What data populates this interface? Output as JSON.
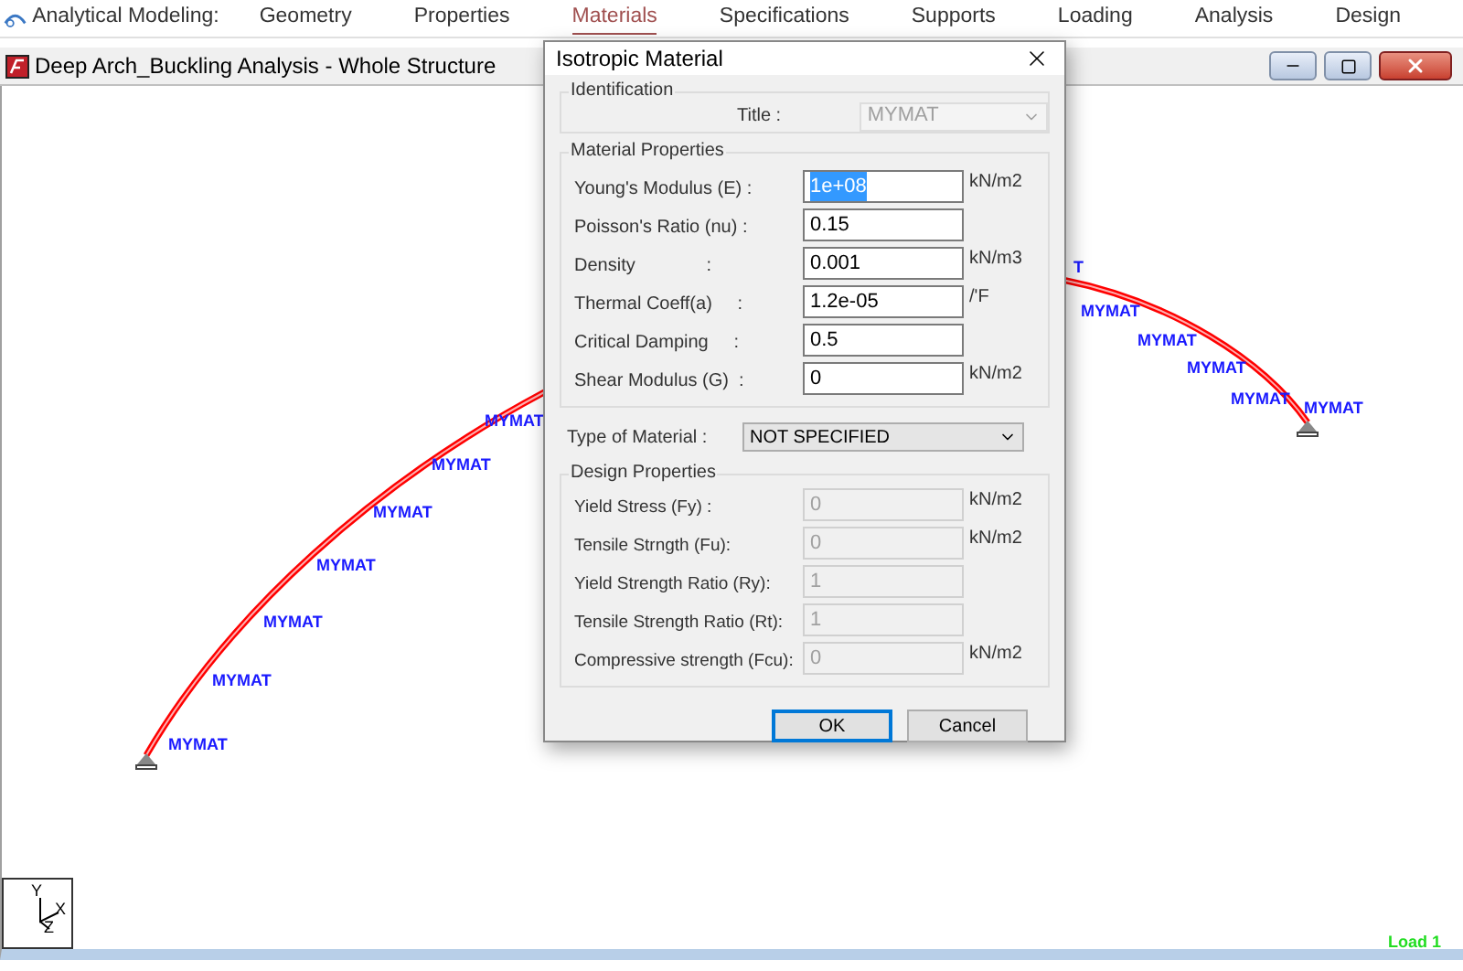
{
  "menu": {
    "app_label": "Analytical Modeling:",
    "items": [
      {
        "label": "Geometry",
        "selected": false
      },
      {
        "label": "Properties",
        "selected": false
      },
      {
        "label": "Materials",
        "selected": true
      },
      {
        "label": "Specifications",
        "selected": false
      },
      {
        "label": "Supports",
        "selected": false
      },
      {
        "label": "Loading",
        "selected": false
      },
      {
        "label": "Analysis",
        "selected": false
      },
      {
        "label": "Design",
        "selected": false
      }
    ]
  },
  "window": {
    "title": "Deep Arch_Buckling Analysis - Whole Structure"
  },
  "canvas": {
    "member_labels": [
      {
        "text": "MYMAT"
      },
      {
        "text": "MYMAT"
      },
      {
        "text": "MYMAT"
      },
      {
        "text": "MYMAT"
      },
      {
        "text": "MYMAT"
      },
      {
        "text": "MYMAT"
      },
      {
        "text": "MYMAT"
      },
      {
        "text": "T"
      },
      {
        "text": "MYMAT"
      },
      {
        "text": "MYMAT"
      },
      {
        "text": "MYMAT"
      },
      {
        "text": "MYMAT"
      },
      {
        "text": "MYMAT"
      }
    ],
    "axes": {
      "y": "Y",
      "x": "X",
      "z": "Z"
    },
    "load_case": "Load 1"
  },
  "dialog": {
    "title": "Isotropic Material",
    "identification": {
      "legend": "Identification",
      "label": "Title :",
      "value": "MYMAT",
      "disabled": true
    },
    "material_properties": {
      "legend": "Material Properties",
      "fields": [
        {
          "label": "Young's Modulus (E) :",
          "value": "1e+08",
          "unit": "kN/m2",
          "highlighted": true
        },
        {
          "label": "Poisson's Ratio (nu) :",
          "value": "0.15",
          "highlighted": false
        },
        {
          "label": "Density              :",
          "value": "0.001",
          "unit": "kN/m3",
          "highlighted": false
        },
        {
          "label": "Thermal Coeff(a)     :",
          "value": "1.2e-05",
          "unit": "/'F",
          "highlighted": false
        },
        {
          "label": "Critical Damping     :",
          "value": "0.5",
          "highlighted": false
        },
        {
          "label": "Shear Modulus (G)  :",
          "value": "0",
          "unit": "kN/m2",
          "highlighted": false
        }
      ]
    },
    "type_of_material": {
      "label": "Type of Material :",
      "value": "NOT SPECIFIED"
    },
    "design_properties": {
      "legend": "Design Properties",
      "fields": [
        {
          "label": "Yield Stress (Fy) :",
          "value": "0",
          "unit": "kN/m2",
          "disabled": true
        },
        {
          "label": "Tensile Strngth (Fu):",
          "value": "0",
          "unit": "kN/m2",
          "disabled": true
        },
        {
          "label": "Yield Strength Ratio (Ry):",
          "value": "1",
          "disabled": true
        },
        {
          "label": "Tensile Strength Ratio (Rt):",
          "value": "1",
          "disabled": true
        },
        {
          "label": "Compressive strength (Fcu):",
          "value": "0",
          "unit": "kN/m2",
          "disabled": true
        }
      ]
    },
    "buttons": [
      {
        "label": "OK",
        "default": true
      },
      {
        "label": "Cancel",
        "default": false
      }
    ]
  }
}
